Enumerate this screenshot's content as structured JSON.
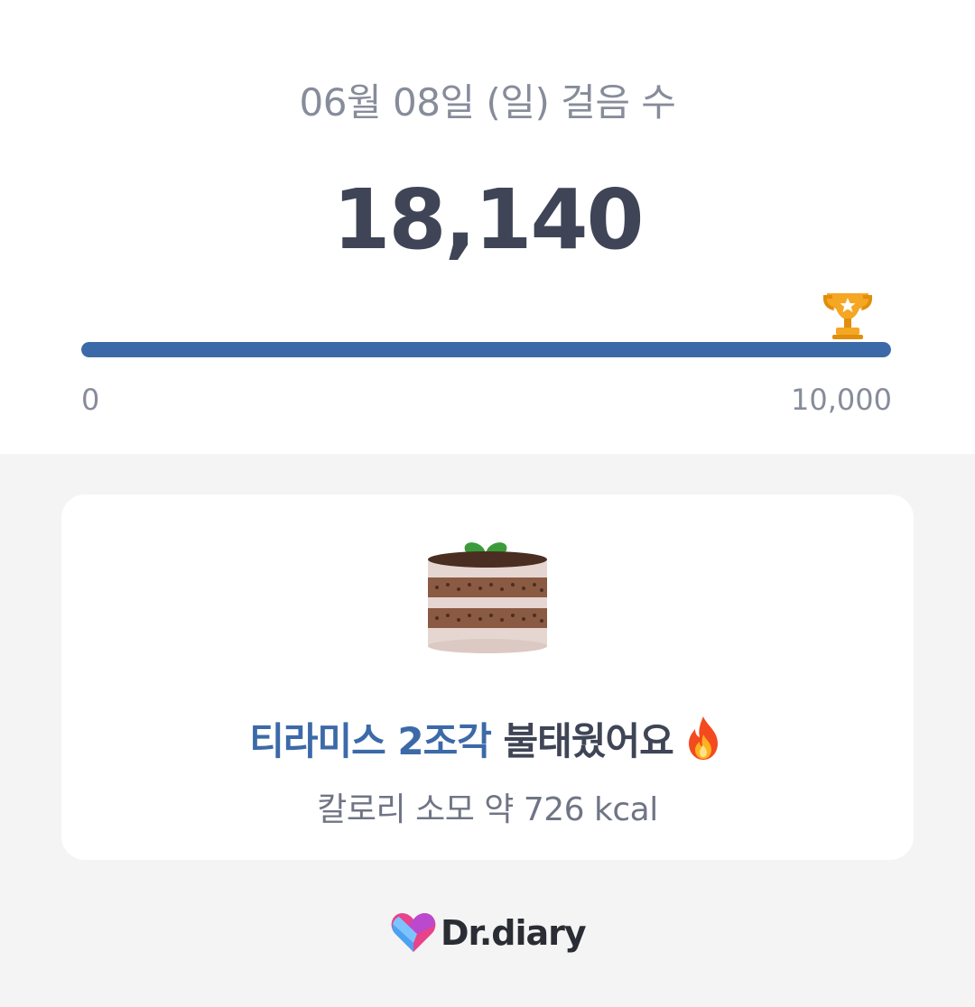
{
  "header": {
    "date_title": "06월 08일 (일) 걸음 수",
    "step_count": "18,140"
  },
  "progress": {
    "value": 18140,
    "goal": 10000,
    "fill_fraction": 1.0,
    "min_label": "0",
    "max_label": "10,000",
    "fill_color": "#3c6aa8"
  },
  "card": {
    "burn_highlight": "티라미스 2조각",
    "burn_text": " 불태웠어요",
    "kcal_text": "칼로리 소모 약 726 kcal",
    "icon": "tiramisu-cake-icon"
  },
  "footer": {
    "brand_name": "Dr.diary"
  }
}
